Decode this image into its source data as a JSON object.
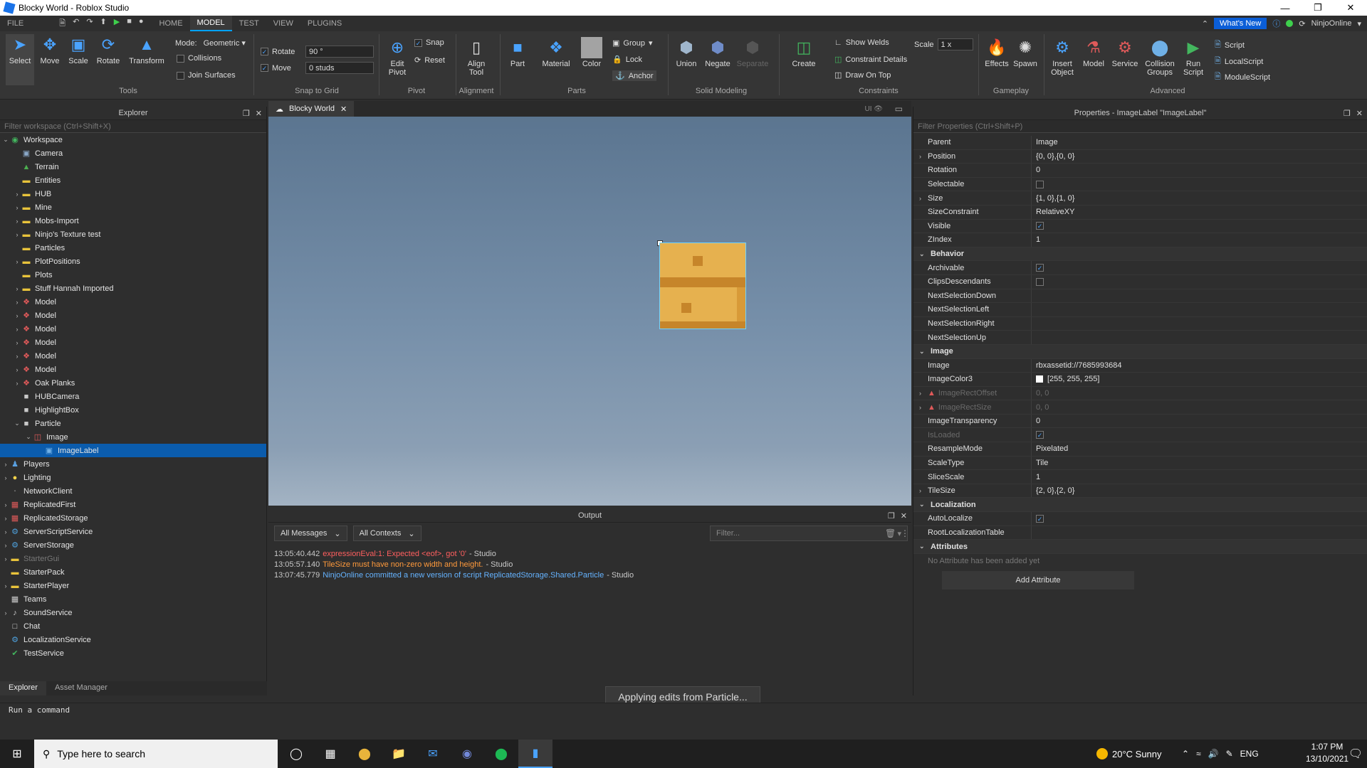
{
  "window": {
    "title": "Blocky World - Roblox Studio"
  },
  "menu": {
    "tabs": [
      "FILE",
      "HOME",
      "MODEL",
      "TEST",
      "VIEW",
      "PLUGINS"
    ],
    "whats_new": "What's New",
    "user": "NinjoOnline"
  },
  "ribbon": {
    "tools": {
      "select": "Select",
      "move": "Move",
      "scale": "Scale",
      "rotate": "Rotate",
      "transform": "Transform",
      "group": "Tools"
    },
    "mode": {
      "label": "Mode:",
      "value": "Geometric",
      "collisions": "Collisions",
      "join_surfaces": "Join Surfaces"
    },
    "snap": {
      "rotate_label": "Rotate",
      "rotate_value": "90 °",
      "move_label": "Move",
      "move_value": "0 studs",
      "group": "Snap to Grid"
    },
    "pivot": {
      "edit_pivot": "Edit Pivot",
      "snap": "Snap",
      "reset": "Reset",
      "group": "Pivot"
    },
    "alignment": {
      "align_tool": "Align Tool",
      "group": "Alignment"
    },
    "parts": {
      "part": "Part",
      "material": "Material",
      "color": "Color",
      "group_btn": "Group",
      "lock": "Lock",
      "anchor": "Anchor",
      "group": "Parts"
    },
    "solid": {
      "union": "Union",
      "negate": "Negate",
      "separate": "Separate",
      "group": "Solid Modeling"
    },
    "constraints": {
      "create": "Create",
      "show_welds": "Show Welds",
      "constraint_details": "Constraint Details",
      "draw_on_top": "Draw On Top",
      "scale_label": "Scale",
      "scale_value": "1 x",
      "group": "Constraints"
    },
    "gameplay": {
      "effects": "Effects",
      "spawn": "Spawn",
      "group": "Gameplay"
    },
    "advanced": {
      "insert_object": "Insert Object",
      "model": "Model",
      "service": "Service",
      "collision_groups": "Collision Groups",
      "run_script": "Run Script",
      "script": "Script",
      "local_script": "LocalScript",
      "module_script": "ModuleScript",
      "group": "Advanced"
    }
  },
  "explorer": {
    "title": "Explorer",
    "filter_placeholder": "Filter workspace (Ctrl+Shift+X)",
    "items": [
      {
        "label": "Workspace",
        "depth": 0,
        "arrow": "open",
        "icon": "globe-icon",
        "color": "#43b65e"
      },
      {
        "label": "Camera",
        "depth": 1,
        "arrow": "",
        "icon": "camera-icon",
        "color": "#8aa8c8"
      },
      {
        "label": "Terrain",
        "depth": 1,
        "arrow": "",
        "icon": "terrain-icon",
        "color": "#4caf50"
      },
      {
        "label": "Entities",
        "depth": 1,
        "arrow": "",
        "icon": "folder-icon",
        "color": "#e8c33b"
      },
      {
        "label": "HUB",
        "depth": 1,
        "arrow": "closed",
        "icon": "folder-icon",
        "color": "#e8c33b"
      },
      {
        "label": "Mine",
        "depth": 1,
        "arrow": "closed",
        "icon": "folder-icon",
        "color": "#e8c33b"
      },
      {
        "label": "Mobs-Import",
        "depth": 1,
        "arrow": "closed",
        "icon": "folder-icon",
        "color": "#e8c33b"
      },
      {
        "label": "Ninjo's Texture test",
        "depth": 1,
        "arrow": "closed",
        "icon": "folder-icon",
        "color": "#e8c33b"
      },
      {
        "label": "Particles",
        "depth": 1,
        "arrow": "",
        "icon": "folder-icon",
        "color": "#e8c33b"
      },
      {
        "label": "PlotPositions",
        "depth": 1,
        "arrow": "closed",
        "icon": "folder-icon",
        "color": "#e8c33b"
      },
      {
        "label": "Plots",
        "depth": 1,
        "arrow": "",
        "icon": "folder-icon",
        "color": "#e8c33b"
      },
      {
        "label": "Stuff Hannah Imported",
        "depth": 1,
        "arrow": "closed",
        "icon": "folder-icon",
        "color": "#e8c33b"
      },
      {
        "label": "Model",
        "depth": 1,
        "arrow": "closed",
        "icon": "model-icon",
        "color": "#e05a5a"
      },
      {
        "label": "Model",
        "depth": 1,
        "arrow": "closed",
        "icon": "model-icon",
        "color": "#e05a5a"
      },
      {
        "label": "Model",
        "depth": 1,
        "arrow": "closed",
        "icon": "model-icon",
        "color": "#e05a5a"
      },
      {
        "label": "Model",
        "depth": 1,
        "arrow": "closed",
        "icon": "model-icon",
        "color": "#e05a5a"
      },
      {
        "label": "Model",
        "depth": 1,
        "arrow": "closed",
        "icon": "model-icon",
        "color": "#e05a5a"
      },
      {
        "label": "Model",
        "depth": 1,
        "arrow": "closed",
        "icon": "model-icon",
        "color": "#e05a5a"
      },
      {
        "label": "Oak Planks",
        "depth": 1,
        "arrow": "closed",
        "icon": "model-icon",
        "color": "#e05a5a"
      },
      {
        "label": "HUBCamera",
        "depth": 1,
        "arrow": "",
        "icon": "part-icon",
        "color": "#c9c9c9"
      },
      {
        "label": "HighlightBox",
        "depth": 1,
        "arrow": "",
        "icon": "part-icon",
        "color": "#c9c9c9"
      },
      {
        "label": "Particle",
        "depth": 1,
        "arrow": "open",
        "icon": "part-icon",
        "color": "#c9c9c9"
      },
      {
        "label": "Image",
        "depth": 2,
        "arrow": "open",
        "icon": "gui-icon",
        "color": "#e05a5a"
      },
      {
        "label": "ImageLabel",
        "depth": 3,
        "arrow": "",
        "icon": "image-label-icon",
        "color": "#6fb0e6",
        "selected": true
      },
      {
        "label": "Players",
        "depth": 0,
        "arrow": "closed",
        "icon": "players-icon",
        "color": "#5aa0e0"
      },
      {
        "label": "Lighting",
        "depth": 0,
        "arrow": "closed",
        "icon": "lighting-icon",
        "color": "#f2d34b"
      },
      {
        "label": "NetworkClient",
        "depth": 0,
        "arrow": "",
        "icon": "network-icon",
        "color": "#aaaaaa"
      },
      {
        "label": "ReplicatedFirst",
        "depth": 0,
        "arrow": "closed",
        "icon": "replicated-first-icon",
        "color": "#e05a5a"
      },
      {
        "label": "ReplicatedStorage",
        "depth": 0,
        "arrow": "closed",
        "icon": "replicated-storage-icon",
        "color": "#e05a5a"
      },
      {
        "label": "ServerScriptService",
        "depth": 0,
        "arrow": "closed",
        "icon": "server-script-service-icon",
        "color": "#4fa3e0"
      },
      {
        "label": "ServerStorage",
        "depth": 0,
        "arrow": "closed",
        "icon": "server-storage-icon",
        "color": "#4fa3e0"
      },
      {
        "label": "StarterGui",
        "depth": 0,
        "arrow": "closed",
        "icon": "starter-gui-icon",
        "color": "#e8c33b",
        "dim": true
      },
      {
        "label": "StarterPack",
        "depth": 0,
        "arrow": "",
        "icon": "starter-pack-icon",
        "color": "#e8c33b"
      },
      {
        "label": "StarterPlayer",
        "depth": 0,
        "arrow": "closed",
        "icon": "starter-player-icon",
        "color": "#e8c33b"
      },
      {
        "label": "Teams",
        "depth": 0,
        "arrow": "",
        "icon": "teams-icon",
        "color": "#cccccc"
      },
      {
        "label": "SoundService",
        "depth": 0,
        "arrow": "closed",
        "icon": "sound-icon",
        "color": "#cccccc"
      },
      {
        "label": "Chat",
        "depth": 0,
        "arrow": "",
        "icon": "chat-icon",
        "color": "#dddddd"
      },
      {
        "label": "LocalizationService",
        "depth": 0,
        "arrow": "",
        "icon": "localization-icon",
        "color": "#4fa3e0"
      },
      {
        "label": "TestService",
        "depth": 0,
        "arrow": "",
        "icon": "test-icon",
        "color": "#43b65e"
      }
    ],
    "bottom_tabs": [
      "Explorer",
      "Asset Manager"
    ]
  },
  "document": {
    "tab_label": "Blocky World",
    "ui_label": "UI"
  },
  "output": {
    "title": "Output",
    "messages_filter": "All Messages",
    "contexts_filter": "All Contexts",
    "filter_placeholder": "Filter...",
    "lines": [
      {
        "time": "13:05:40.442",
        "text": "expressionEval:1: Expected <eof>, got '0'",
        "source": " - Studio",
        "color": "#ff5f5f"
      },
      {
        "time": "13:05:57.140",
        "text": "TileSize must have non-zero width and height.",
        "source": " - Studio",
        "color": "#ff9a3c"
      },
      {
        "time": "13:07:45.779",
        "text": "NinjoOnline committed a new version of script ReplicatedStorage.Shared.Particle",
        "source": " - Studio",
        "color": "#65b3ff"
      }
    ]
  },
  "properties": {
    "title": "Properties - ImageLabel \"ImageLabel\"",
    "filter_placeholder": "Filter Properties (Ctrl+Shift+P)",
    "rows": [
      {
        "name": "Parent",
        "value": "Image"
      },
      {
        "name": "Position",
        "value": "{0, 0},{0, 0}",
        "expand": true
      },
      {
        "name": "Rotation",
        "value": "0"
      },
      {
        "name": "Selectable",
        "value": "",
        "checkbox": false
      },
      {
        "name": "Size",
        "value": "{1, 0},{1, 0}",
        "expand": true
      },
      {
        "name": "SizeConstraint",
        "value": "RelativeXY"
      },
      {
        "name": "Visible",
        "value": "",
        "checkbox": true
      },
      {
        "name": "ZIndex",
        "value": "1"
      },
      {
        "name": "Behavior",
        "category": true
      },
      {
        "name": "Archivable",
        "value": "",
        "checkbox": true
      },
      {
        "name": "ClipsDescendants",
        "value": "",
        "checkbox": false
      },
      {
        "name": "NextSelectionDown",
        "value": ""
      },
      {
        "name": "NextSelectionLeft",
        "value": ""
      },
      {
        "name": "NextSelectionRight",
        "value": ""
      },
      {
        "name": "NextSelectionUp",
        "value": ""
      },
      {
        "name": "Image",
        "category": true
      },
      {
        "name": "Image",
        "value": "rbxassetid://7685993684"
      },
      {
        "name": "ImageColor3",
        "value": "[255, 255, 255]",
        "swatch": "#ffffff"
      },
      {
        "name": "ImageRectOffset",
        "value": "0, 0",
        "dim": true,
        "warn": true,
        "expand": true
      },
      {
        "name": "ImageRectSize",
        "value": "0, 0",
        "dim": true,
        "warn": true,
        "expand": true
      },
      {
        "name": "ImageTransparency",
        "value": "0"
      },
      {
        "name": "IsLoaded",
        "value": "",
        "dim": true,
        "checkbox": true
      },
      {
        "name": "ResampleMode",
        "value": "Pixelated"
      },
      {
        "name": "ScaleType",
        "value": "Tile"
      },
      {
        "name": "SliceScale",
        "value": "1"
      },
      {
        "name": "TileSize",
        "value": "{2, 0},{2, 0}",
        "expand": true
      },
      {
        "name": "Localization",
        "category": true
      },
      {
        "name": "AutoLocalize",
        "value": "",
        "checkbox": true
      },
      {
        "name": "RootLocalizationTable",
        "value": ""
      },
      {
        "name": "Attributes",
        "category": true
      }
    ],
    "no_attributes": "No Attribute has been added yet",
    "add_attribute": "Add Attribute"
  },
  "command_bar": {
    "placeholder": "Run a command"
  },
  "toast": "Applying edits from Particle...",
  "taskbar": {
    "search_placeholder": "Type here to search",
    "weather": "20°C  Sunny",
    "lang": "ENG",
    "time": "1:07 PM",
    "date": "13/10/2021"
  }
}
